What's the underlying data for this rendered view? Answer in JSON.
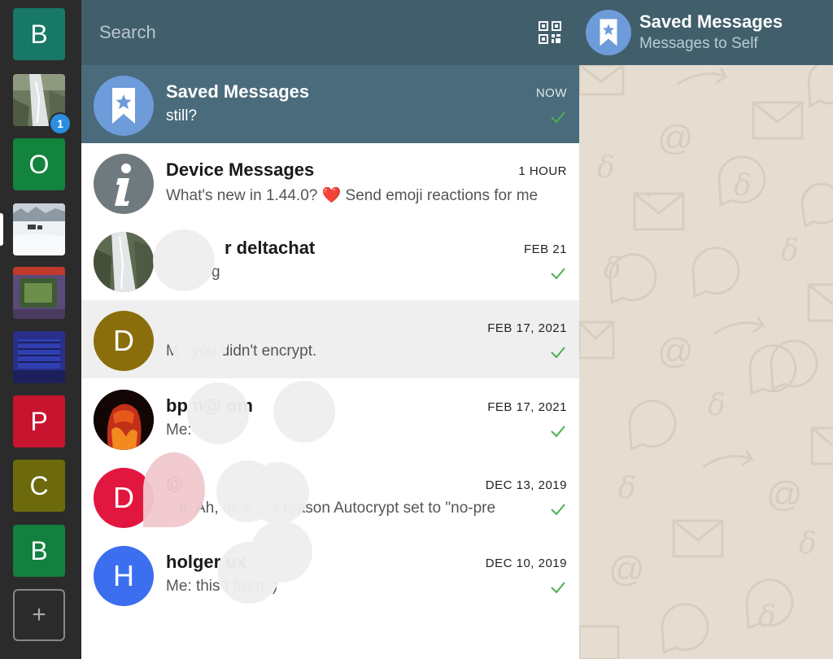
{
  "accounts": [
    {
      "letter": "B",
      "color": "#177867",
      "kind": "letter"
    },
    {
      "letter": "",
      "kind": "photo-waterfall",
      "badge": "1"
    },
    {
      "letter": "O",
      "color": "#13843d",
      "kind": "letter"
    },
    {
      "letter": "",
      "kind": "photo-snow"
    },
    {
      "letter": "",
      "kind": "photo-monitor"
    },
    {
      "letter": "",
      "kind": "photo-truck"
    },
    {
      "letter": "P",
      "color": "#c8142f",
      "kind": "letter"
    },
    {
      "letter": "C",
      "color": "#6c6a0c",
      "kind": "letter"
    },
    {
      "letter": "B",
      "color": "#13803f",
      "kind": "letter"
    }
  ],
  "rail": {
    "add_label": "+"
  },
  "search": {
    "placeholder": "Search"
  },
  "chats": [
    {
      "name": "Saved Messages",
      "preview": "still?",
      "time": "NOW",
      "avatar_kind": "saved",
      "avatar_color": "#6e9bd9",
      "check": true,
      "selected": true
    },
    {
      "name": "Device Messages",
      "preview": "What's new in 1.44.0? ❤️ Send emoji reactions for me",
      "time": "1 HOUR",
      "avatar_kind": "info",
      "avatar_color": "#6f7a7e",
      "check": false
    },
    {
      "name": "r deltachat",
      "preview": "g",
      "time": "FEB 21",
      "avatar_kind": "photo-waterfall",
      "check": true
    },
    {
      "name": "",
      "preview": "M                . you didn't encrypt.",
      "time": "FEB 17, 2021",
      "avatar_kind": "letter",
      "avatar_letter": "D",
      "avatar_color": "#8a6e0b",
      "check": true,
      "hover": true
    },
    {
      "name": "bp           n@          om",
      "preview": "Me:",
      "time": "FEB 17, 2021",
      "avatar_kind": "photo-fist",
      "check": true
    },
    {
      "name": "       @",
      "preview": "e: Ah,        or some reason Autocrypt set to \"no-pre",
      "time": "DEC 13, 2019",
      "avatar_kind": "letter",
      "avatar_letter": "D",
      "avatar_color": "#e2173f",
      "check": true
    },
    {
      "name": "holger          ux",
      "preview": "Me: this           t from :)",
      "time": "DEC 10, 2019",
      "avatar_kind": "letter",
      "avatar_letter": "H",
      "avatar_color": "#3b6ff0",
      "check": true
    }
  ],
  "header": {
    "title": "Saved Messages",
    "subtitle": "Messages to Self"
  },
  "colors": {
    "header_bg": "#415e6b",
    "selected_bg": "#4a6b7b",
    "check": "#4caf50",
    "wallpaper": "#e6ddd2"
  }
}
